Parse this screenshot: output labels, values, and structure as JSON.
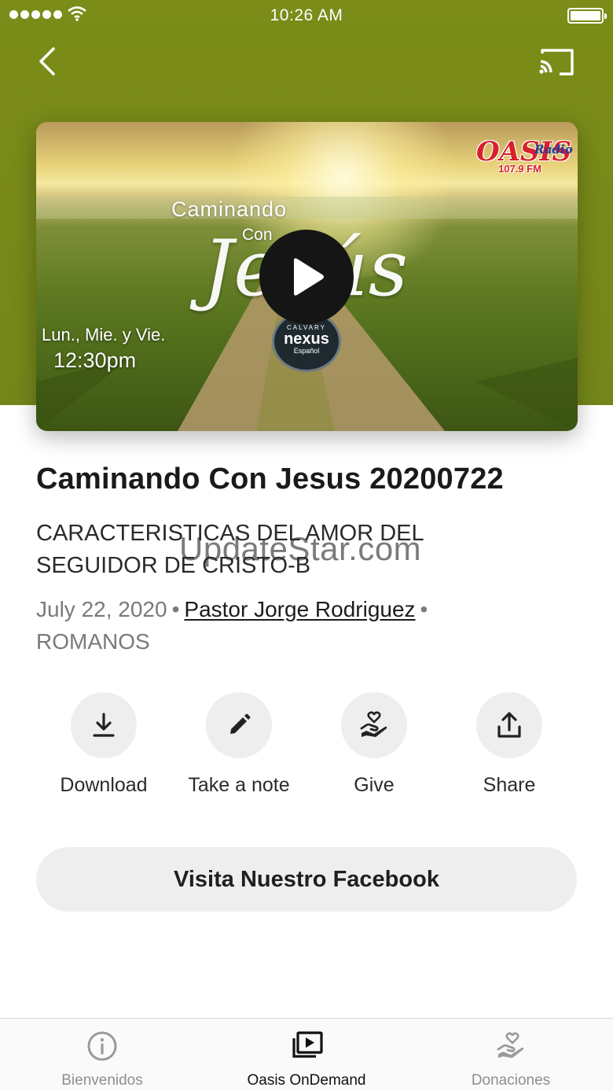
{
  "status_bar": {
    "time": "10:26 AM"
  },
  "artwork": {
    "title_line1": "Caminando",
    "title_line2": "Con",
    "title_script": "Jesús",
    "days": "Lun., Mie. y Vie.",
    "hour": "12:30pm",
    "station_name": "OASIS",
    "station_sub": "Radio",
    "station_freq": "107.9 FM",
    "badge_top": "CALVARY",
    "badge_mid": "nexus",
    "badge_bot": "Español"
  },
  "episode": {
    "title": "Caminando Con Jesus 20200722",
    "subtitle": "CARACTERISTICAS DEL AMOR DEL SEGUIDOR DE CRISTO-B",
    "date": "July 22, 2020",
    "author": "Pastor Jorge Rodriguez",
    "series": "ROMANOS",
    "separator": "•"
  },
  "watermark": "UpdateStar.com",
  "actions": {
    "download": "Download",
    "note": "Take a note",
    "give": "Give",
    "share": "Share"
  },
  "facebook_button": "Visita Nuestro Facebook",
  "tabs": {
    "welcome": "Bienvenidos",
    "ondemand": "Oasis OnDemand",
    "donations": "Donaciones"
  },
  "colors": {
    "header_green": "#7b8c18",
    "button_gray": "#eeeeee",
    "active_tab": "#111111",
    "inactive_tab": "#8e8e8e"
  }
}
